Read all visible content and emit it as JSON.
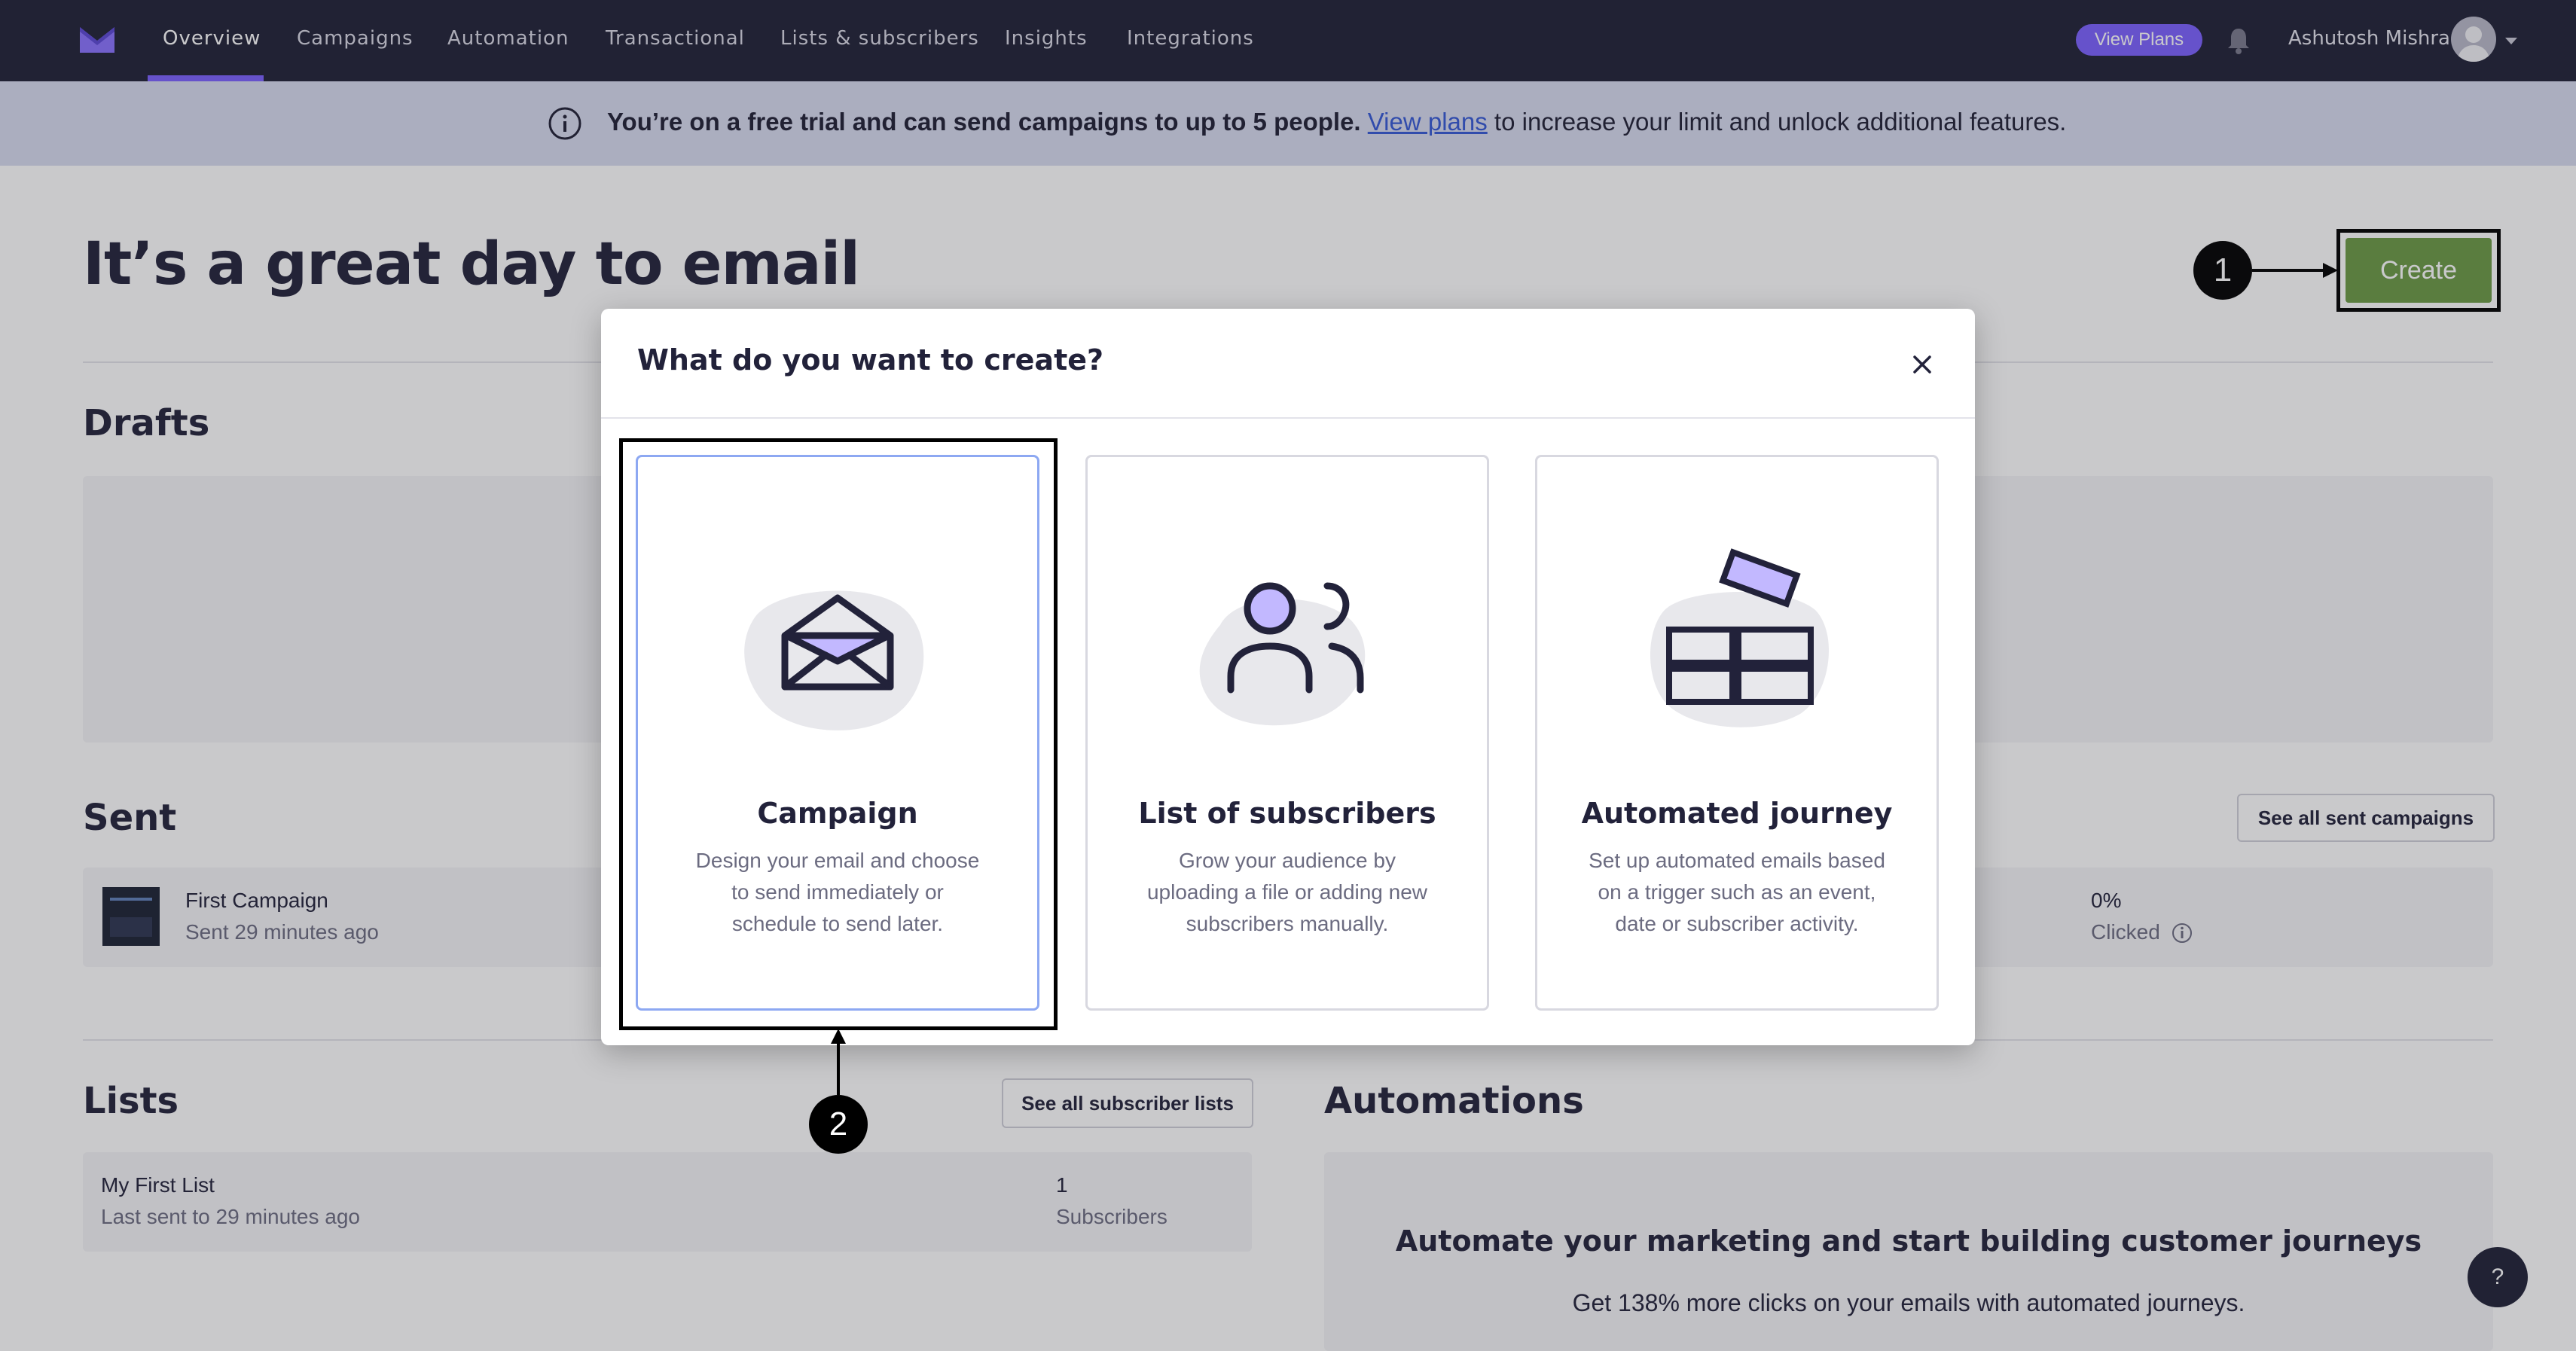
{
  "nav": {
    "items": [
      "Overview",
      "Campaigns",
      "Automation",
      "Transactional",
      "Lists & subscribers",
      "Insights",
      "Integrations"
    ],
    "view_plans": "View Plans",
    "user_name": "Ashutosh Mishra"
  },
  "banner": {
    "bold_text": "You’re on a free trial and can send campaigns to up to 5 people.",
    "link_text": "View plans",
    "rest_text": " to increase your limit and unlock additional features."
  },
  "page": {
    "heading": "It’s a great day to email",
    "create_label": "Create",
    "drafts_heading": "Drafts",
    "sent_heading": "Sent",
    "see_all_sent": "See all sent campaigns",
    "sent_item": {
      "name": "First Campaign",
      "time": "Sent 29 minutes ago",
      "clicked_value": "0%",
      "clicked_label": "Clicked"
    },
    "lists_heading": "Lists",
    "see_all_lists": "See all subscriber lists",
    "list_item": {
      "name": "My First List",
      "time": "Last sent to 29 minutes ago",
      "count": "1",
      "count_label": "Subscribers"
    },
    "automations_heading": "Automations",
    "automations_title": "Automate your marketing and start building customer journeys",
    "automations_sub": "Get 138% more clicks on your emails with automated journeys."
  },
  "modal": {
    "title": "What do you want to create?",
    "cards": [
      {
        "title": "Campaign",
        "desc": "Design your email and choose to send immediately or schedule to send later."
      },
      {
        "title": "List of subscribers",
        "desc": "Grow your audience by uploading a file or adding new subscribers manually."
      },
      {
        "title": "Automated journey",
        "desc": "Set up automated emails based on a trigger such as an event, date or subscriber activity."
      }
    ]
  },
  "markers": [
    "1",
    "2"
  ],
  "help_label": "?",
  "colors": {
    "nav_bg": "#1f2036",
    "accent": "#7b61ff",
    "create_green": "#6b9a45",
    "banner_bg": "#d7dbef",
    "link": "#3559d6"
  }
}
